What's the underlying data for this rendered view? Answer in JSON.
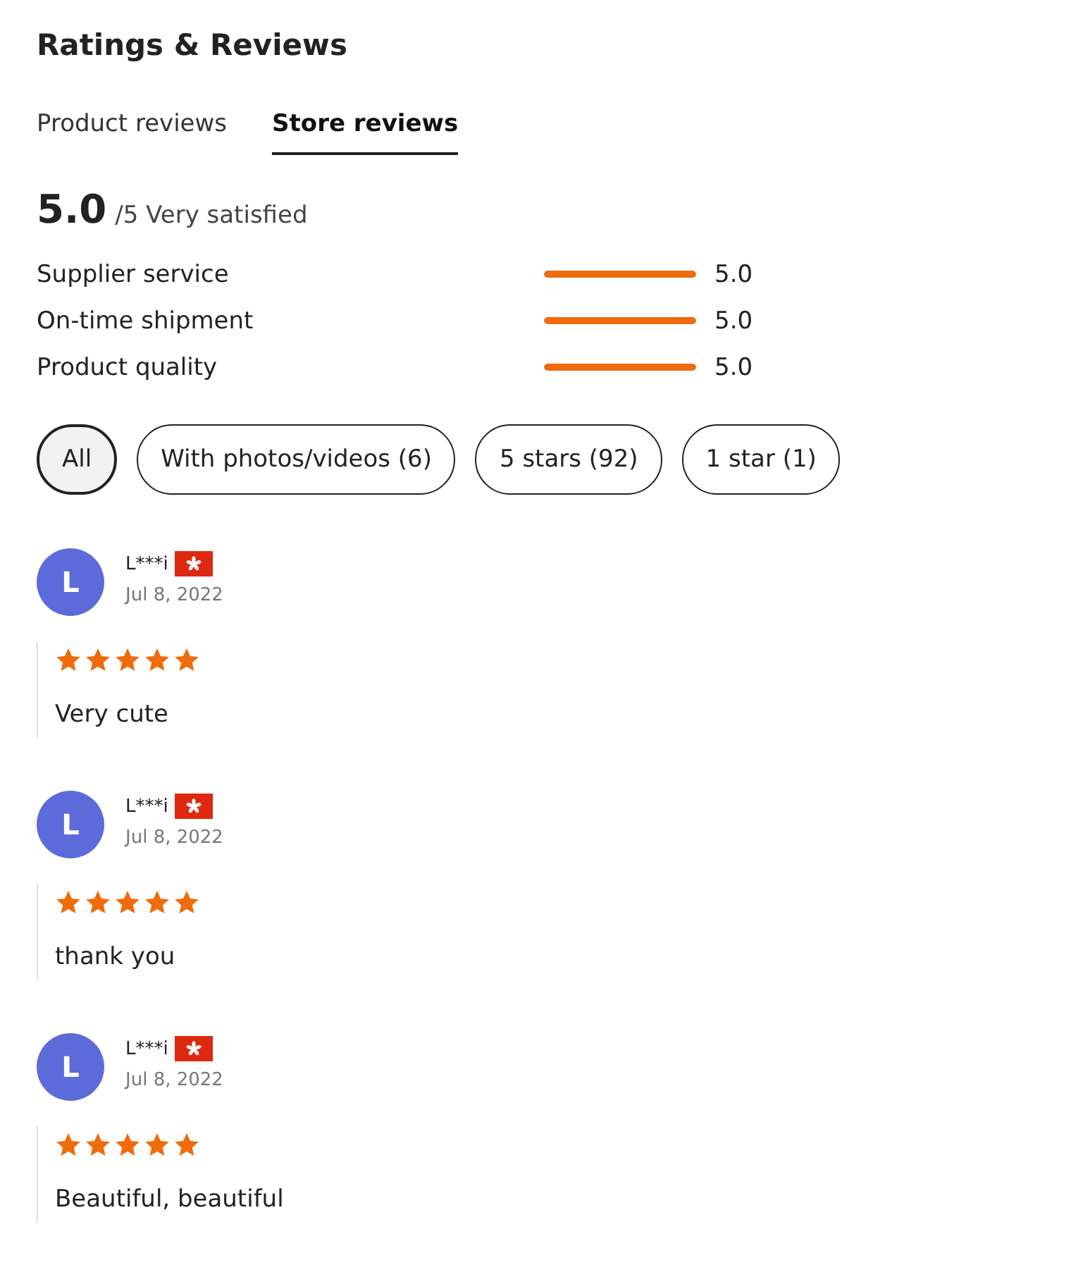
{
  "title": "Ratings & Reviews",
  "tabs": [
    {
      "label": "Product reviews",
      "selected": false
    },
    {
      "label": "Store reviews",
      "selected": true
    }
  ],
  "summary": {
    "score": "5.0",
    "scale": "/5 Very satisfied"
  },
  "ratings": [
    {
      "name": "Supplier service",
      "level": 1,
      "reading": "5.0"
    },
    {
      "name": "On-time shipment",
      "level": 1,
      "reading": "5.0"
    },
    {
      "name": "Product quality",
      "level": 1,
      "reading": "5.0"
    }
  ],
  "filters": [
    {
      "label": "All",
      "selected": true
    },
    {
      "label": "With photos/videos (6)",
      "selected": false
    },
    {
      "label": "5 stars (92)",
      "selected": false
    },
    {
      "label": "1 star (1)",
      "selected": false
    }
  ],
  "reviews": [
    {
      "initial": "L",
      "name": "L***i",
      "date": "Jul 8, 2022",
      "stars": 5,
      "text": "Very cute"
    },
    {
      "initial": "L",
      "name": "L***i",
      "date": "Jul 8, 2022",
      "stars": 5,
      "text": "thank you"
    },
    {
      "initial": "L",
      "name": "L***i",
      "date": "Jul 8, 2022",
      "stars": 5,
      "text": "Beautiful, beautiful"
    }
  ]
}
